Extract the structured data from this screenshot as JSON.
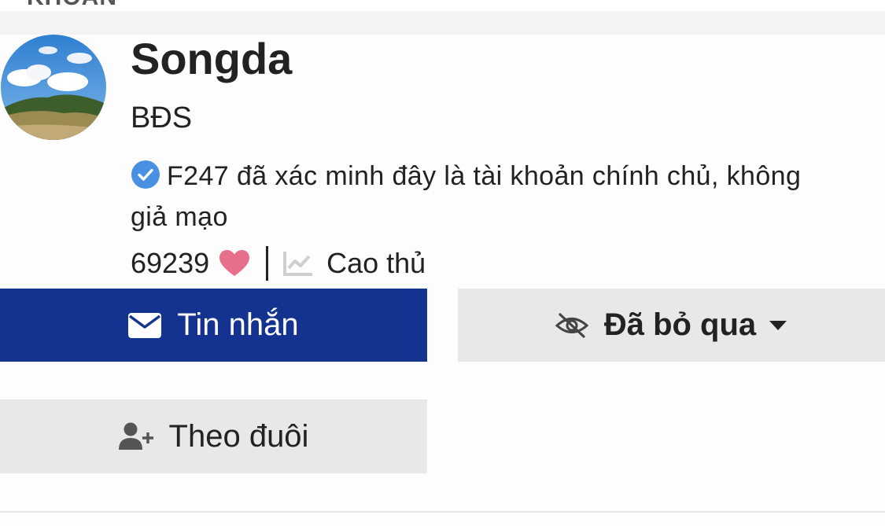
{
  "header": {
    "title": "KHOẢN"
  },
  "profile": {
    "name": "Songda",
    "subtitle": "BĐS",
    "verification_text": "F247 đã xác minh đây là tài khoản chính chủ, không giả mạo",
    "likes_count": "69239",
    "rank": "Cao thủ"
  },
  "actions": {
    "message_label": "Tin nhắn",
    "ignored_label": "Đã bỏ qua",
    "follow_label": "Theo đuôi"
  },
  "colors": {
    "primary": "#143390",
    "verified": "#4a90e2",
    "heart": "#e86f8a",
    "secondary_button": "#e8e8e8"
  },
  "icons": {
    "verified": "check-circle-icon",
    "likes": "heart-icon",
    "rank": "chart-line-icon",
    "message": "envelope-icon",
    "ignored": "eye-slash-icon",
    "dropdown": "caret-down-icon",
    "follow": "user-plus-icon"
  }
}
